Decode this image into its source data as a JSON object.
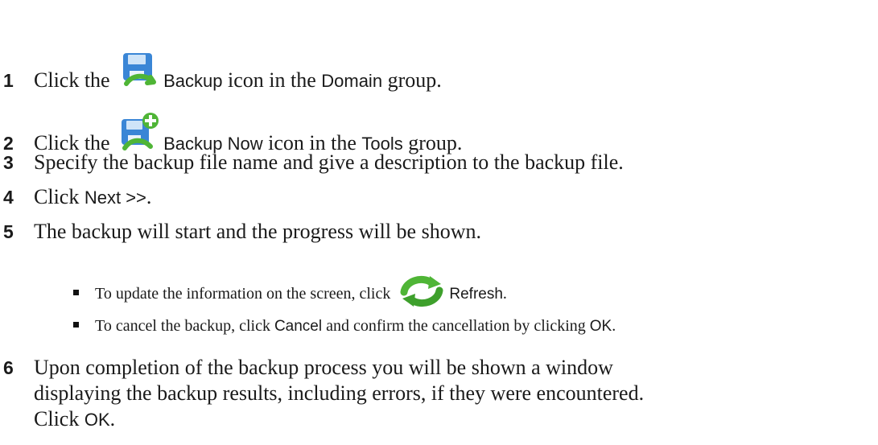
{
  "steps": [
    {
      "number": "1",
      "text_a": "Click the",
      "ui_a": "Backup",
      "text_b": "icon in the",
      "ui_b": "Domain",
      "text_c": "group.",
      "icon": "backup-icon"
    },
    {
      "number": "2",
      "text_a": "Click the",
      "ui_a": "Backup Now",
      "text_b": "icon in the",
      "ui_b": "Tools",
      "text_c": "group.",
      "icon": "backup-now-icon"
    },
    {
      "number": "3",
      "text": "Specify the backup file name and give a description to the backup file."
    },
    {
      "number": "4",
      "text_a": "Click",
      "ui_a": "Next >>",
      "text_b": "."
    },
    {
      "number": "5",
      "text": "The backup will start and the progress will be shown."
    },
    {
      "number": "6",
      "line1": "Upon completion of the backup process you will be shown a window",
      "line2": "displaying the backup results, including errors, if they were encountered.",
      "text_a": "Click",
      "ui_a": "OK",
      "text_b": "."
    }
  ],
  "bullets": [
    {
      "text_a": "To update the information on the screen, click",
      "ui_a": "Refresh",
      "text_b": ".",
      "icon": "refresh-icon"
    },
    {
      "text_a": "To cancel the backup, click",
      "ui_a": "Cancel",
      "text_b": "and confirm the cancellation by clicking",
      "ui_b": "OK",
      "text_c": "."
    }
  ],
  "colors": {
    "icon_blue": "#3a86d6",
    "icon_green": "#4fb536",
    "text": "#1a1a1a"
  }
}
